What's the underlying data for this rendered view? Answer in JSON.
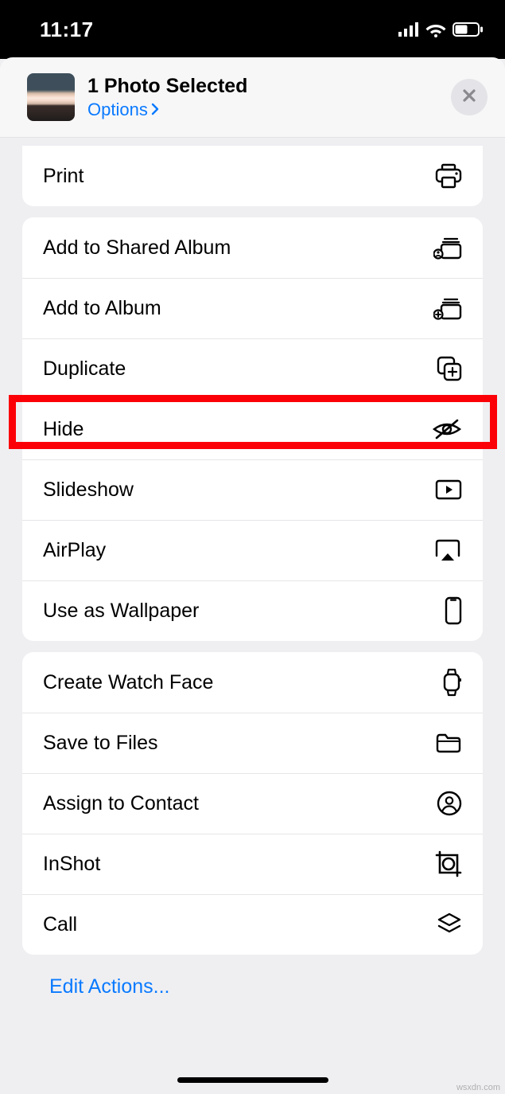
{
  "status": {
    "time": "11:17"
  },
  "header": {
    "title": "1 Photo Selected",
    "options": "Options"
  },
  "groups": [
    {
      "rows": [
        {
          "label": "Print",
          "icon": "printer"
        }
      ]
    },
    {
      "rows": [
        {
          "label": "Add to Shared Album",
          "icon": "shared-album"
        },
        {
          "label": "Add to Album",
          "icon": "add-album"
        },
        {
          "label": "Duplicate",
          "icon": "duplicate"
        },
        {
          "label": "Hide",
          "icon": "hide",
          "highlighted": true
        },
        {
          "label": "Slideshow",
          "icon": "slideshow"
        },
        {
          "label": "AirPlay",
          "icon": "airplay"
        },
        {
          "label": "Use as Wallpaper",
          "icon": "phone"
        }
      ]
    },
    {
      "rows": [
        {
          "label": "Create Watch Face",
          "icon": "watch"
        },
        {
          "label": "Save to Files",
          "icon": "folder"
        },
        {
          "label": "Assign to Contact",
          "icon": "contact"
        },
        {
          "label": "InShot",
          "icon": "inshot"
        },
        {
          "label": "Call",
          "icon": "layers"
        }
      ]
    }
  ],
  "footer": {
    "edit": "Edit Actions..."
  },
  "watermark": "wsxdn.com"
}
